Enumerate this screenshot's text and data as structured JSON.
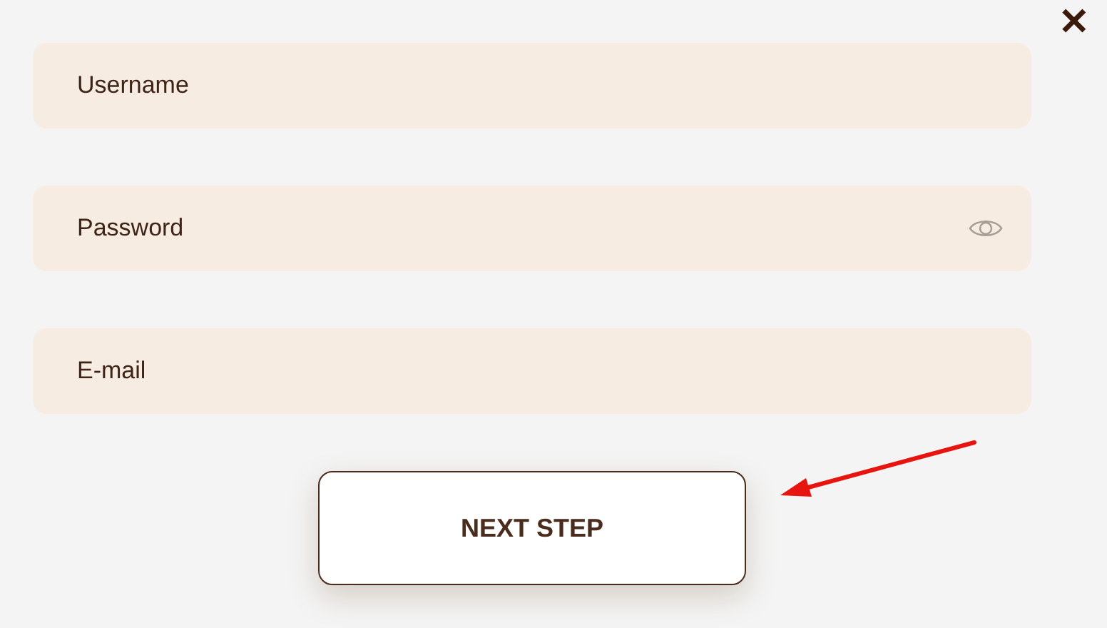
{
  "close_button": {
    "label": "✕"
  },
  "fields": [
    {
      "kind": "text",
      "placeholder": "Username"
    },
    {
      "kind": "password",
      "placeholder": "Password"
    },
    {
      "kind": "text",
      "placeholder": "E-mail"
    }
  ],
  "next_button": {
    "label": "NEXT STEP"
  }
}
